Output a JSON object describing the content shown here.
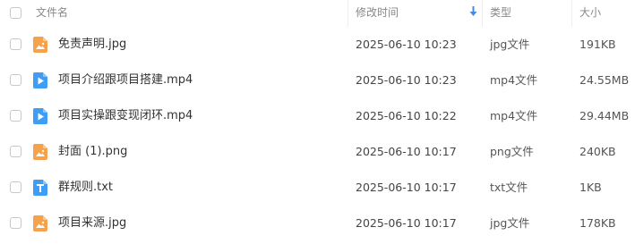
{
  "header": {
    "name_label": "文件名",
    "modified_label": "修改时间",
    "type_label": "类型",
    "size_label": "大小",
    "sort_color": "#3b8cf5"
  },
  "colors": {
    "image_icon": "#f7a24a",
    "video_icon": "#3e9df5",
    "text_icon": "#3e9df5"
  },
  "files": [
    {
      "name": "免责声明.jpg",
      "modified": "2025-06-10 10:23",
      "type": "jpg文件",
      "size": "191KB",
      "icon": "image-file-icon"
    },
    {
      "name": "项目介绍跟项目搭建.mp4",
      "modified": "2025-06-10 10:23",
      "type": "mp4文件",
      "size": "24.55MB",
      "icon": "video-file-icon"
    },
    {
      "name": "项目实操跟变现闭环.mp4",
      "modified": "2025-06-10 10:22",
      "type": "mp4文件",
      "size": "29.44MB",
      "icon": "video-file-icon"
    },
    {
      "name": "封面 (1).png",
      "modified": "2025-06-10 10:17",
      "type": "png文件",
      "size": "240KB",
      "icon": "image-file-icon"
    },
    {
      "name": "群规则.txt",
      "modified": "2025-06-10 10:17",
      "type": "txt文件",
      "size": "1KB",
      "icon": "text-file-icon"
    },
    {
      "name": "项目来源.jpg",
      "modified": "2025-06-10 10:17",
      "type": "jpg文件",
      "size": "178KB",
      "icon": "image-file-icon"
    }
  ]
}
